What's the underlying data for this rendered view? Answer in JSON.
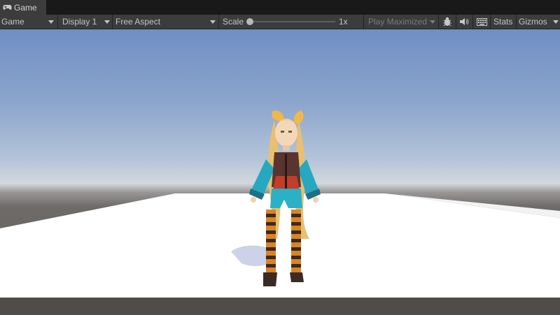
{
  "tab": {
    "icon": "gamepad-icon",
    "label": "Game"
  },
  "toolbar": {
    "view_select": "Game",
    "display_select": "Display 1",
    "aspect_select": "Free Aspect",
    "scale_label": "Scale",
    "scale_value_text": "1x",
    "scale_level": 0.0,
    "play_mode_select": "Play Maximized",
    "bug_icon": "bug-icon",
    "audio_icon": "speaker-icon",
    "keyboard_icon": "keyboard-icon",
    "stats_label": "Stats",
    "gizmos_label": "Gizmos"
  },
  "colors": {
    "toolbar_bg": "#3c3c3c",
    "tabbar_bg": "#191919",
    "text": "#c4c4c4",
    "sky_top": "#6f8fc3",
    "horizon": "#d2d8df",
    "floor": "#ffffff",
    "ground": "#5d5a58"
  }
}
